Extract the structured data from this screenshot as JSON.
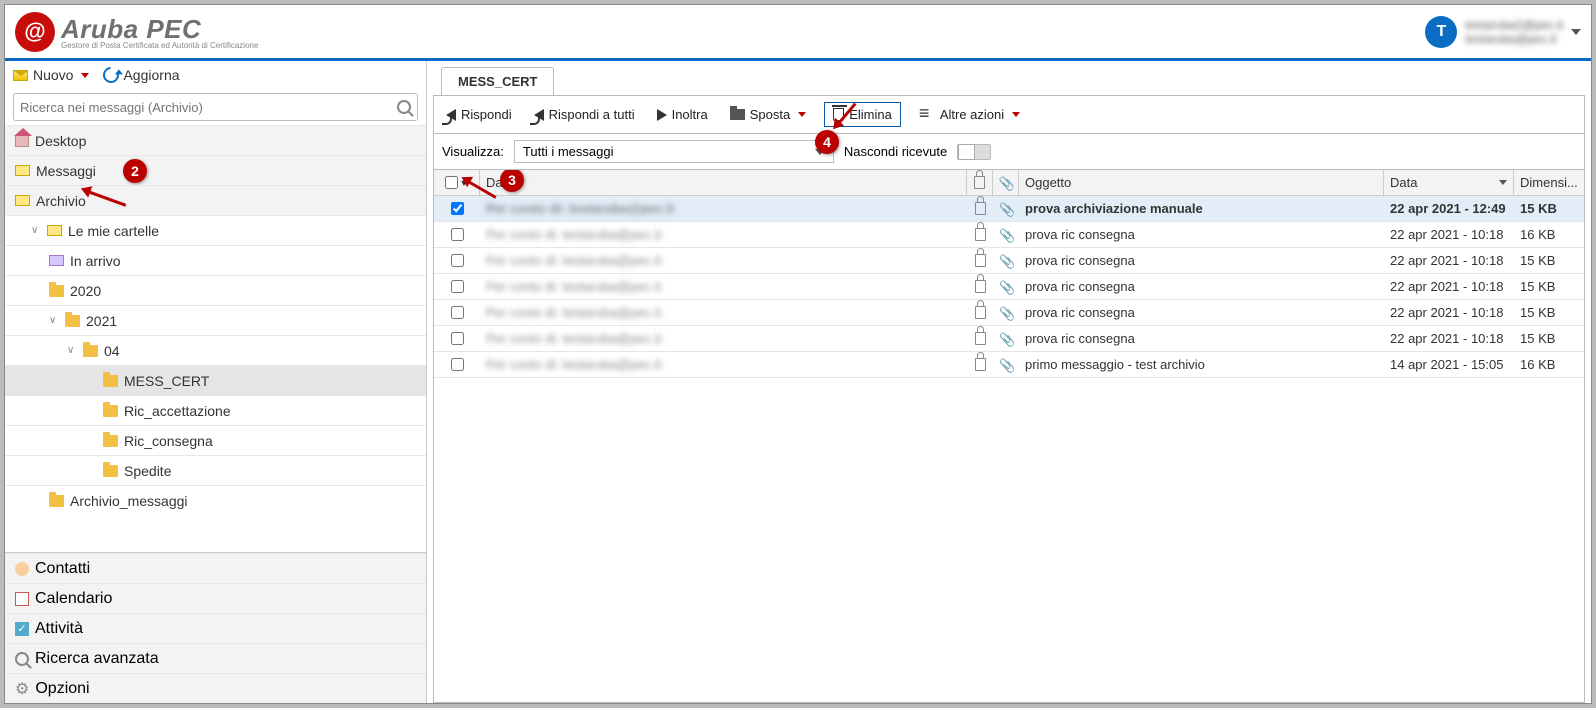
{
  "brand": {
    "name": "Aruba PEC",
    "sub": "Gestore di Posta Certificata ed Autorità di Certificazione"
  },
  "account": {
    "initial": "T",
    "line1": "testaruba2@pec.it",
    "line2": "testaruba@pec.it"
  },
  "sidebar": {
    "new": "Nuovo",
    "refresh": "Aggiorna",
    "search_ph": "Ricerca nei messaggi (Archivio)",
    "desktop": "Desktop",
    "messages": "Messaggi",
    "archive": "Archivio",
    "myfolders": "Le mie cartelle",
    "inbox": "In arrivo",
    "y2020": "2020",
    "y2021": "2021",
    "m04": "04",
    "mess_cert": "MESS_CERT",
    "ric_acc": "Ric_accettazione",
    "ric_con": "Ric_consegna",
    "spedite": "Spedite",
    "arch_msg": "Archivio_messaggi",
    "contacts": "Contatti",
    "calendar": "Calendario",
    "tasks": "Attività",
    "advsearch": "Ricerca avanzata",
    "options": "Opzioni"
  },
  "annotations": {
    "b2": "2",
    "b3": "3",
    "b4": "4"
  },
  "main": {
    "tab": "MESS_CERT",
    "toolbar": {
      "reply": "Rispondi",
      "replyall": "Rispondi a tutti",
      "forward": "Inoltra",
      "move": "Sposta",
      "delete": "Elimina",
      "more": "Altre azioni"
    },
    "view_lbl": "Visualizza:",
    "view_sel": "Tutti i messaggi",
    "hide_rec": "Nascondi ricevute",
    "cols": {
      "da": "Da",
      "oggetto": "Oggetto",
      "data": "Data",
      "dim": "Dimensi..."
    },
    "rows": [
      {
        "checked": true,
        "from": "Per conto di: testaruba@pec.it",
        "subject": "prova archiviazione manuale",
        "date": "22 apr 2021 - 12:49",
        "size": "15 KB",
        "sel": true
      },
      {
        "checked": false,
        "from": "Per conto di: testaruba@pec.it",
        "subject": "prova ric consegna",
        "date": "22 apr 2021 - 10:18",
        "size": "16 KB"
      },
      {
        "checked": false,
        "from": "Per conto di: testaruba@pec.it",
        "subject": "prova ric consegna",
        "date": "22 apr 2021 - 10:18",
        "size": "15 KB"
      },
      {
        "checked": false,
        "from": "Per conto di: testaruba@pec.it",
        "subject": "prova ric consegna",
        "date": "22 apr 2021 - 10:18",
        "size": "15 KB"
      },
      {
        "checked": false,
        "from": "Per conto di: testaruba@pec.it",
        "subject": "prova ric consegna",
        "date": "22 apr 2021 - 10:18",
        "size": "15 KB"
      },
      {
        "checked": false,
        "from": "Per conto di: testaruba@pec.it",
        "subject": "prova ric consegna",
        "date": "22 apr 2021 - 10:18",
        "size": "15 KB"
      },
      {
        "checked": false,
        "from": "Per conto di: testaruba@pec.it",
        "subject": "primo messaggio - test archivio",
        "date": "14 apr 2021 - 15:05",
        "size": "16 KB"
      }
    ]
  }
}
